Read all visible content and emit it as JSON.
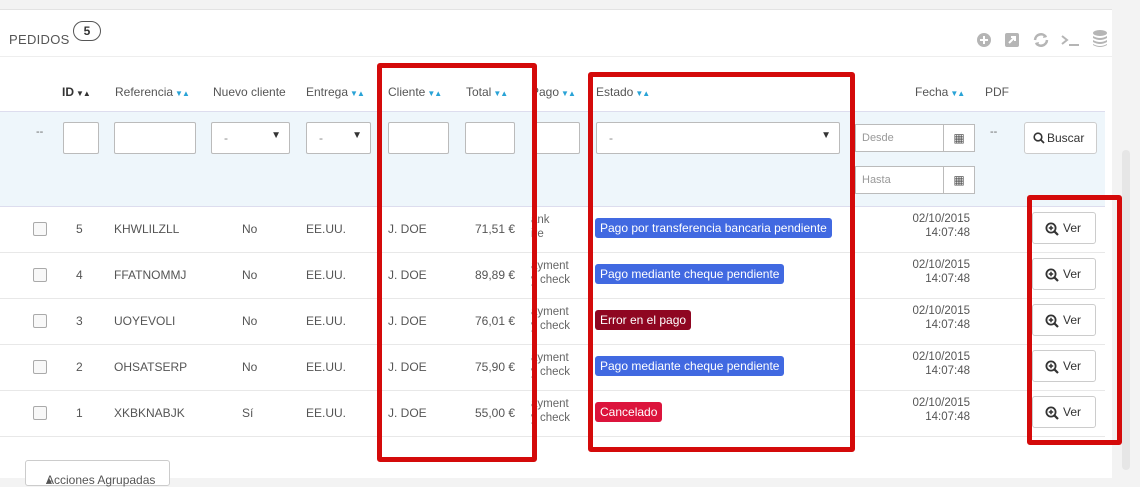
{
  "header": {
    "title": "PEDIDOS",
    "count": "5"
  },
  "toolbar": {
    "icons": [
      "add-icon",
      "export-icon",
      "refresh-icon",
      "sql-icon",
      "database-icon"
    ]
  },
  "columns": {
    "id": "ID",
    "referencia": "Referencia",
    "nuevo_cliente": "Nuevo cliente",
    "entrega": "Entrega",
    "cliente": "Cliente",
    "total": "Total",
    "pago": "Pago",
    "estado": "Estado",
    "fecha": "Fecha",
    "pdf": "PDF"
  },
  "filters": {
    "leading_dash": "--",
    "nuevo_cliente_value": "-",
    "entrega_value": "-",
    "estado_value": "-",
    "desde_placeholder": "Desde",
    "hasta_placeholder": "Hasta",
    "pdf_dash": "--",
    "search_label": "Buscar"
  },
  "rows": [
    {
      "id": "5",
      "ref": "KHWLILZLL",
      "nuevo": "No",
      "entrega": "EE.UU.",
      "cliente": "J. DOE",
      "total": "71,51 €",
      "pago": "ank\nire",
      "estado": "Pago por transferencia bancaria pendiente",
      "estado_color": "#4169e1",
      "fecha": "02/10/2015",
      "hora": "14:07:48",
      "ver": "Ver"
    },
    {
      "id": "4",
      "ref": "FFATNOMMJ",
      "nuevo": "No",
      "entrega": "EE.UU.",
      "cliente": "J. DOE",
      "total": "89,89 €",
      "pago": "ayment\ny check",
      "estado": "Pago mediante cheque pendiente",
      "estado_color": "#4169e1",
      "fecha": "02/10/2015",
      "hora": "14:07:48",
      "ver": "Ver"
    },
    {
      "id": "3",
      "ref": "UOYEVOLI",
      "nuevo": "No",
      "entrega": "EE.UU.",
      "cliente": "J. DOE",
      "total": "76,01 €",
      "pago": "ayment\ny check",
      "estado": "Error en el pago",
      "estado_color": "#8f0621",
      "fecha": "02/10/2015",
      "hora": "14:07:48",
      "ver": "Ver"
    },
    {
      "id": "2",
      "ref": "OHSATSERP",
      "nuevo": "No",
      "entrega": "EE.UU.",
      "cliente": "J. DOE",
      "total": "75,90 €",
      "pago": "ayment\ny check",
      "estado": "Pago mediante cheque pendiente",
      "estado_color": "#4169e1",
      "fecha": "02/10/2015",
      "hora": "14:07:48",
      "ver": "Ver"
    },
    {
      "id": "1",
      "ref": "XKBKNABJK",
      "nuevo": "Sí",
      "entrega": "EE.UU.",
      "cliente": "J. DOE",
      "total": "55,00 €",
      "pago": "ayment\ny check",
      "estado": "Cancelado",
      "estado_color": "#dc143c",
      "fecha": "02/10/2015",
      "hora": "14:07:48",
      "ver": "Ver"
    }
  ],
  "bulk_actions": {
    "label": "Acciones Agrupadas"
  },
  "colors": {
    "accent_sort": "#29a3d6",
    "highlight_box": "#d40a0a",
    "filter_bg": "#eef6fb"
  }
}
